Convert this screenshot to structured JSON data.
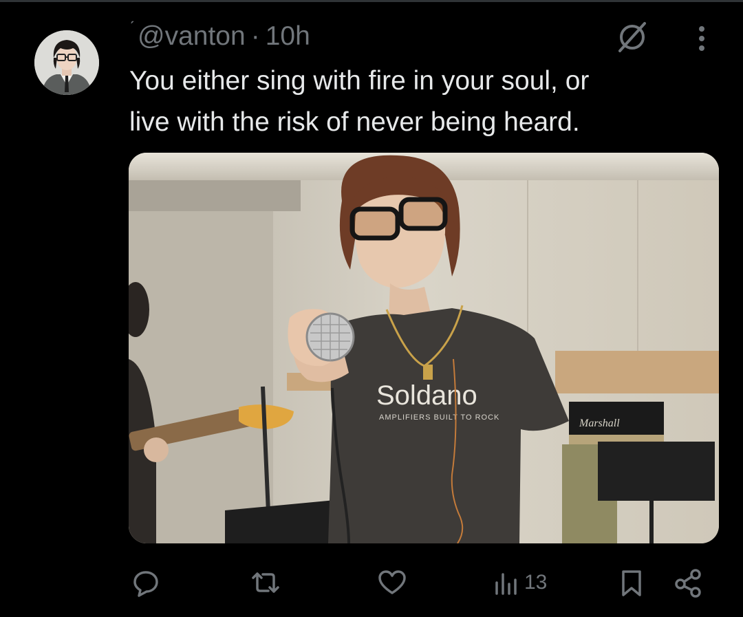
{
  "tweet": {
    "handle": "@vanton",
    "separator": "·",
    "time": "10h",
    "text_lines": [
      "You either sing with fire in your soul, or",
      "live with the risk of never being heard."
    ]
  },
  "photo": {
    "shirt_text": "Soldano",
    "shirt_subtext": "AMPLIFIERS BUILT TO ROCK",
    "amp_logo": "Marshall"
  },
  "actions": {
    "views": "13"
  },
  "colors": {
    "background": "#000000",
    "text": "#e7e9ea",
    "muted": "#71767b",
    "divider": "#2f3336"
  },
  "icons": [
    "avatar",
    "hide-icon",
    "more-icon",
    "reply-icon",
    "retweet-icon",
    "like-icon",
    "views-icon",
    "bookmark-icon",
    "share-icon"
  ]
}
